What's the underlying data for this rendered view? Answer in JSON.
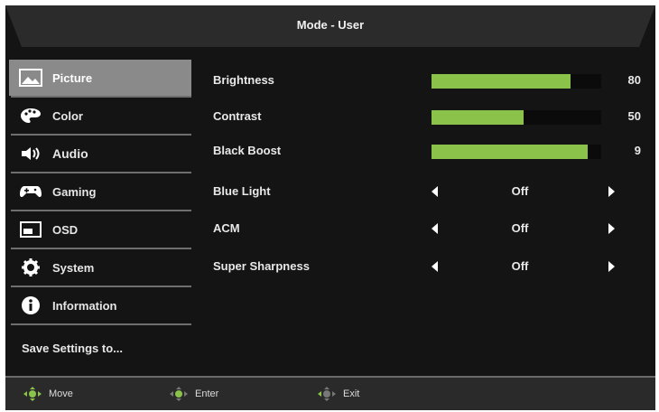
{
  "header": {
    "title": "Mode - User"
  },
  "sidebar": {
    "items": [
      {
        "label": "Picture",
        "icon": "picture-icon",
        "selected": true
      },
      {
        "label": "Color",
        "icon": "palette-icon",
        "selected": false
      },
      {
        "label": "Audio",
        "icon": "speaker-icon",
        "selected": false
      },
      {
        "label": "Gaming",
        "icon": "gamepad-icon",
        "selected": false
      },
      {
        "label": "OSD",
        "icon": "osd-icon",
        "selected": false
      },
      {
        "label": "System",
        "icon": "gear-icon",
        "selected": false
      },
      {
        "label": "Information",
        "icon": "info-icon",
        "selected": false
      }
    ],
    "save_label": "Save Settings to..."
  },
  "settings": {
    "sliders": [
      {
        "label": "Brightness",
        "value": "80",
        "level": 0.82
      },
      {
        "label": "Contrast",
        "value": "50",
        "level": 0.54
      },
      {
        "label": "Black Boost",
        "value": "9",
        "level": 0.92
      }
    ],
    "options": [
      {
        "label": "Blue Light",
        "value": "Off"
      },
      {
        "label": "ACM",
        "value": "Off"
      },
      {
        "label": "Super Sharpness",
        "value": "Off"
      }
    ]
  },
  "footer": {
    "move": "Move",
    "enter": "Enter",
    "exit": "Exit"
  },
  "colors": {
    "accent": "#8bc34a",
    "background": "#141414",
    "selected": "#8a8a8a"
  }
}
